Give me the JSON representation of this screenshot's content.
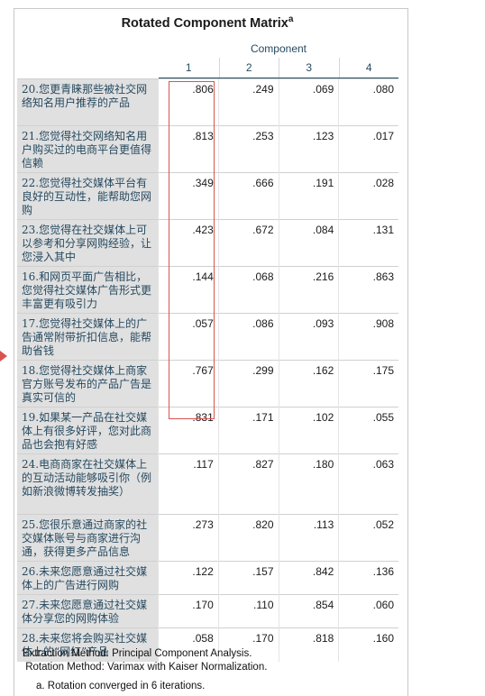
{
  "title": "Rotated Component Matrix",
  "title_superscript": "a",
  "component_header": "Component",
  "component_numbers": [
    "1",
    "2",
    "3",
    "4"
  ],
  "rows": [
    {
      "label": "20.您更青睐那些被社交网络知名用户推荐的产品",
      "values": [
        ".806",
        ".249",
        ".069",
        ".080"
      ]
    },
    {
      "label": "21.您觉得社交网络知名用户购买过的电商平台更值得信赖",
      "values": [
        ".813",
        ".253",
        ".123",
        ".017"
      ]
    },
    {
      "label": "22.您觉得社交媒体平台有良好的互动性，能帮助您网购",
      "values": [
        ".349",
        ".666",
        ".191",
        ".028"
      ]
    },
    {
      "label": "23.您觉得在社交媒体上可以参考和分享网购经验，让您浸入其中",
      "values": [
        ".423",
        ".672",
        ".084",
        ".131"
      ]
    },
    {
      "label": "16.和网页平面广告相比，您觉得社交媒体广告形式更丰富更有吸引力",
      "values": [
        ".144",
        ".068",
        ".216",
        ".863"
      ]
    },
    {
      "label": "17.您觉得社交媒体上的广告通常附带折扣信息，能帮助省钱",
      "values": [
        ".057",
        ".086",
        ".093",
        ".908"
      ]
    },
    {
      "label": "18.您觉得社交媒体上商家官方账号发布的产品广告是真实可信的",
      "values": [
        ".767",
        ".299",
        ".162",
        ".175"
      ]
    },
    {
      "label": "19.如果某一产品在社交媒体上有很多好评，您对此商品也会抱有好感",
      "values": [
        ".831",
        ".171",
        ".102",
        ".055"
      ]
    },
    {
      "label": "24.电商商家在社交媒体上的互动活动能够吸引你（例如新浪微博转发抽奖）",
      "values": [
        ".117",
        ".827",
        ".180",
        ".063"
      ]
    },
    {
      "label": "25.您很乐意通过商家的社交媒体账号与商家进行沟通，获得更多产品信息",
      "values": [
        ".273",
        ".820",
        ".113",
        ".052"
      ]
    },
    {
      "label": "26.未来您愿意通过社交媒体上的广告进行网购",
      "values": [
        ".122",
        ".157",
        ".842",
        ".136"
      ]
    },
    {
      "label": "27.未来您愿意通过社交媒体分享您的网购体验",
      "values": [
        ".170",
        ".110",
        ".854",
        ".060"
      ]
    },
    {
      "label": "28.未来您将会购买社交媒体上的“网红”产品",
      "values": [
        ".058",
        ".170",
        ".818",
        ".160"
      ]
    }
  ],
  "footnotes": {
    "extraction": "Extraction Method: Principal Component Analysis.",
    "rotation": " Rotation Method: Varimax with Kaiser Normalization.",
    "note_a": "a. Rotation converged in 6 iterations."
  },
  "annotation_color": "#d9534f"
}
